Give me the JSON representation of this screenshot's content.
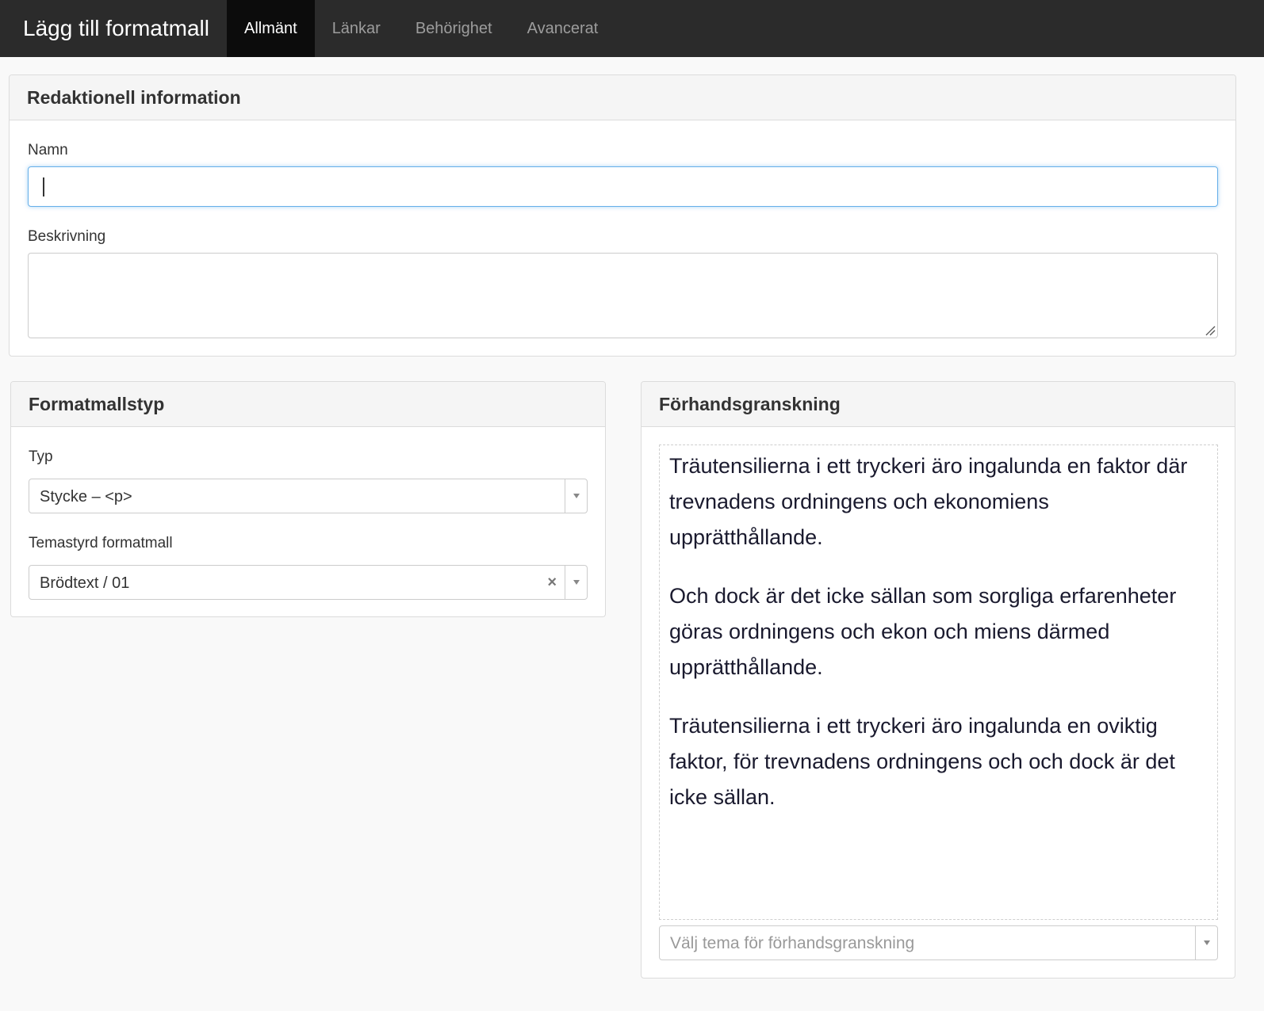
{
  "navbar": {
    "title": "Lägg till formatmall",
    "tabs": [
      {
        "label": "Allmänt",
        "active": true
      },
      {
        "label": "Länkar",
        "active": false
      },
      {
        "label": "Behörighet",
        "active": false
      },
      {
        "label": "Avancerat",
        "active": false
      }
    ]
  },
  "editorial": {
    "heading": "Redaktionell information",
    "name_label": "Namn",
    "name_value": "",
    "description_label": "Beskrivning",
    "description_value": ""
  },
  "style_type": {
    "heading": "Formatmallstyp",
    "type_label": "Typ",
    "type_value": "Stycke – <p>",
    "theme_label": "Temastyrd formatmall",
    "theme_value": "Brödtext / 01",
    "theme_clear": "×"
  },
  "preview": {
    "heading": "Förhandsgranskning",
    "paragraphs": [
      "Träutensilierna i ett tryckeri äro ingalunda en faktor där trevnadens ordningens och ekonomiens upprätthållande.",
      "Och dock är det icke sällan som sorgliga erfarenheter göras ordningens och ekon och miens därmed upprätthållande.",
      "Träutensilierna i ett tryckeri äro ingalunda en oviktig faktor, för trevnadens ordningens och och dock är det icke sällan."
    ],
    "theme_placeholder": "Välj tema för förhandsgranskning"
  },
  "colors": {
    "navbar_bg": "#2b2b2b",
    "active_tab_bg": "#0c0c0c",
    "focus_border": "#66afe9"
  }
}
